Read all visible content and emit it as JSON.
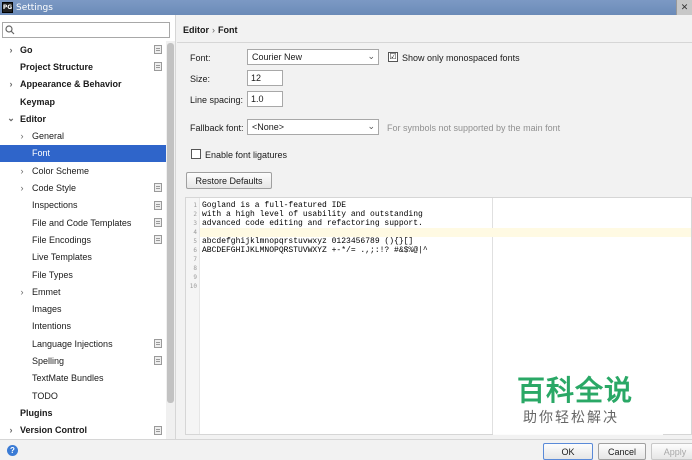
{
  "window": {
    "title": "Settings",
    "app_icon": "PG",
    "close_glyph": "✕"
  },
  "search": {
    "placeholder": "",
    "icon_glyph": "⌕"
  },
  "sidebar": {
    "items": [
      {
        "label": "Go",
        "bold": true,
        "arrow": "›",
        "indent": 0,
        "project": true
      },
      {
        "label": "Project Structure",
        "bold": true,
        "arrow": "",
        "indent": 0,
        "project": true
      },
      {
        "label": "Appearance & Behavior",
        "bold": true,
        "arrow": "›",
        "indent": 0,
        "project": false
      },
      {
        "label": "Keymap",
        "bold": true,
        "arrow": "",
        "indent": 0,
        "project": false
      },
      {
        "label": "Editor",
        "bold": true,
        "arrow": "⌄",
        "indent": 0,
        "project": false
      },
      {
        "label": "General",
        "bold": false,
        "arrow": "›",
        "indent": 1,
        "project": false
      },
      {
        "label": "Font",
        "bold": false,
        "arrow": "",
        "indent": 1,
        "project": false,
        "selected": true
      },
      {
        "label": "Color Scheme",
        "bold": false,
        "arrow": "›",
        "indent": 1,
        "project": false
      },
      {
        "label": "Code Style",
        "bold": false,
        "arrow": "›",
        "indent": 1,
        "project": true
      },
      {
        "label": "Inspections",
        "bold": false,
        "arrow": "",
        "indent": 1,
        "project": true
      },
      {
        "label": "File and Code Templates",
        "bold": false,
        "arrow": "",
        "indent": 1,
        "project": true
      },
      {
        "label": "File Encodings",
        "bold": false,
        "arrow": "",
        "indent": 1,
        "project": true
      },
      {
        "label": "Live Templates",
        "bold": false,
        "arrow": "",
        "indent": 1,
        "project": false
      },
      {
        "label": "File Types",
        "bold": false,
        "arrow": "",
        "indent": 1,
        "project": false
      },
      {
        "label": "Emmet",
        "bold": false,
        "arrow": "›",
        "indent": 1,
        "project": false
      },
      {
        "label": "Images",
        "bold": false,
        "arrow": "",
        "indent": 1,
        "project": false
      },
      {
        "label": "Intentions",
        "bold": false,
        "arrow": "",
        "indent": 1,
        "project": false
      },
      {
        "label": "Language Injections",
        "bold": false,
        "arrow": "",
        "indent": 1,
        "project": true
      },
      {
        "label": "Spelling",
        "bold": false,
        "arrow": "",
        "indent": 1,
        "project": true
      },
      {
        "label": "TextMate Bundles",
        "bold": false,
        "arrow": "",
        "indent": 1,
        "project": false
      },
      {
        "label": "TODO",
        "bold": false,
        "arrow": "",
        "indent": 1,
        "project": false
      },
      {
        "label": "Plugins",
        "bold": true,
        "arrow": "",
        "indent": 0,
        "project": false
      },
      {
        "label": "Version Control",
        "bold": true,
        "arrow": "›",
        "indent": 0,
        "project": true
      }
    ]
  },
  "breadcrumb": {
    "parent": "Editor",
    "separator": "›",
    "current": "Font"
  },
  "form": {
    "font_label": "Font:",
    "font_value": "Courier New",
    "mono_checked": "☑",
    "mono_label": "Show only monospaced fonts",
    "size_label": "Size:",
    "size_value": "12",
    "spacing_label": "Line spacing:",
    "spacing_value": "1.0",
    "fallback_label": "Fallback font:",
    "fallback_value": "<None>",
    "fallback_hint": "For symbols not supported by the main font",
    "ligatures_checked": "",
    "ligatures_label": "Enable font ligatures",
    "restore_label": "Restore Defaults",
    "chevron": "⌄"
  },
  "preview": {
    "lines": [
      "Gogland is a full-featured IDE",
      "with a high level of usability and outstanding",
      "advanced code editing and refactoring support.",
      "",
      "abcdefghijklmnopqrstuvwxyz 0123456789 (){}[]",
      "ABCDEFGHIJKLMNOPQRSTUVWXYZ +-*/= .,;:!? #&$%@|^",
      "",
      "",
      "",
      ""
    ],
    "line_numbers": [
      "1",
      "2",
      "3",
      "4",
      "5",
      "6",
      "7",
      "8",
      "9",
      "10"
    ]
  },
  "watermark": {
    "big": "百科全说",
    "small": "助你轻松解决"
  },
  "footer": {
    "help_glyph": "?",
    "ok": "OK",
    "cancel": "Cancel",
    "apply": "Apply"
  }
}
